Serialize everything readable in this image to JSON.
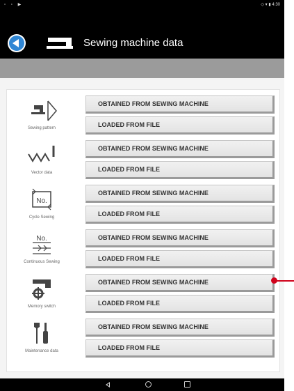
{
  "statusbar": {
    "left": "▫ ▫ ▶",
    "right": "◇ ▾ ▮ 4:30"
  },
  "appbar": {
    "title": "Sewing machine data"
  },
  "rows": [
    {
      "label": "Sewing pattern",
      "icon": "sewing-pattern-icon",
      "btn1": "OBTAINED FROM SEWING MACHINE",
      "btn2": "LOADED FROM FILE"
    },
    {
      "label": "Vector data",
      "icon": "vector-data-icon",
      "btn1": "OBTAINED FROM SEWING MACHINE",
      "btn2": "LOADED FROM FILE"
    },
    {
      "label": "Cycle Sewing",
      "icon": "cycle-sewing-icon",
      "btn1": "OBTAINED FROM SEWING MACHINE",
      "btn2": "LOADED FROM FILE"
    },
    {
      "label": "Continuous Sewing",
      "icon": "continuous-sewing-icon",
      "btn1": "OBTAINED FROM SEWING MACHINE",
      "btn2": "LOADED FROM FILE"
    },
    {
      "label": "Memory switch",
      "icon": "memory-switch-icon",
      "btn1": "OBTAINED FROM SEWING MACHINE",
      "btn2": "LOADED FROM FILE"
    },
    {
      "label": "Maintenance data",
      "icon": "maintenance-data-icon",
      "btn1": "OBTAINED FROM SEWING MACHINE",
      "btn2": "LOADED FROM FILE"
    }
  ],
  "icons": {
    "cycle_no": "No.",
    "continuous_no": "No."
  },
  "colors": {
    "accent": "#2f86d4",
    "pointer": "#d0021b"
  }
}
